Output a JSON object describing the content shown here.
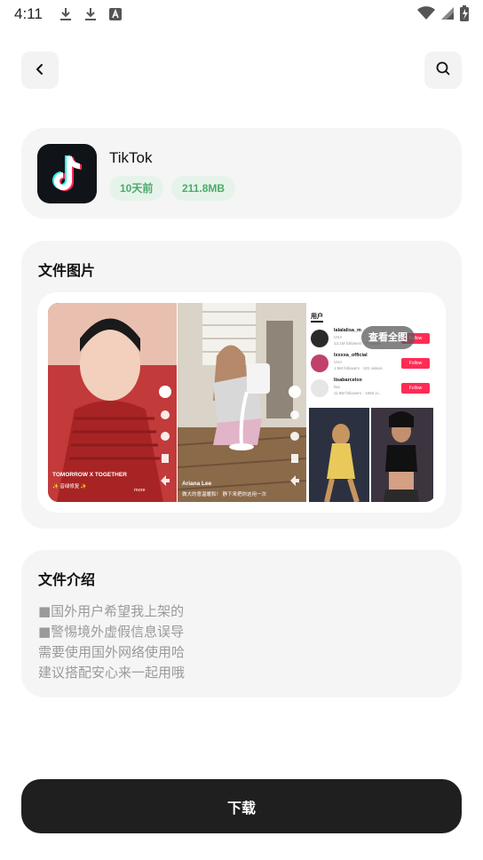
{
  "status_bar": {
    "time": "4:11",
    "left_icons": [
      "download-icon",
      "download-icon",
      "font-icon"
    ],
    "right_icons": [
      "wifi-icon",
      "signal-icon",
      "battery-icon"
    ]
  },
  "nav": {
    "back_icon": "chevron-left-icon",
    "search_icon": "search-icon"
  },
  "app": {
    "name": "TikTok",
    "updated": "10天前",
    "size": "211.8MB"
  },
  "screenshots": {
    "title": "文件图片",
    "view_all": "查看全图",
    "shot1": {
      "caption": "TOMORROW X TOGETHER",
      "sub": "✨ 音绿修复 ✨",
      "more": "more"
    },
    "shot2": {
      "caption": "Ariana Lee",
      "sub": "做大的意温暖和！ 静下来把你这用一次"
    },
    "shot3": {
      "header": "用户",
      "users": [
        {
          "name": "lalalalisa_m",
          "meta": "USA",
          "stats": "13.1M followers · 7 videos",
          "button": "Follow"
        },
        {
          "name": "lxxxxa_official",
          "meta": "USA",
          "stats": "1.5M followers · 101 videos",
          "button": "Follow"
        },
        {
          "name": "lisabarcelox",
          "meta": "lisa",
          "stats": "11.8M followers · 1665 vi...",
          "button": "Follow"
        }
      ]
    }
  },
  "intro": {
    "title": "文件介绍",
    "lines": [
      "■国外用户希望我上架的",
      "■警惕境外虚假信息误导",
      "需要使用国外网络使用哈",
      "建议搭配安心来一起用哦"
    ]
  },
  "download_label": "下载",
  "colors": {
    "accent_green": "#4aab6a",
    "tag_bg": "#e6f3ea",
    "card_bg": "#f5f5f5",
    "button_bg": "#1f1f1f",
    "follow_red": "#fe2c55"
  }
}
